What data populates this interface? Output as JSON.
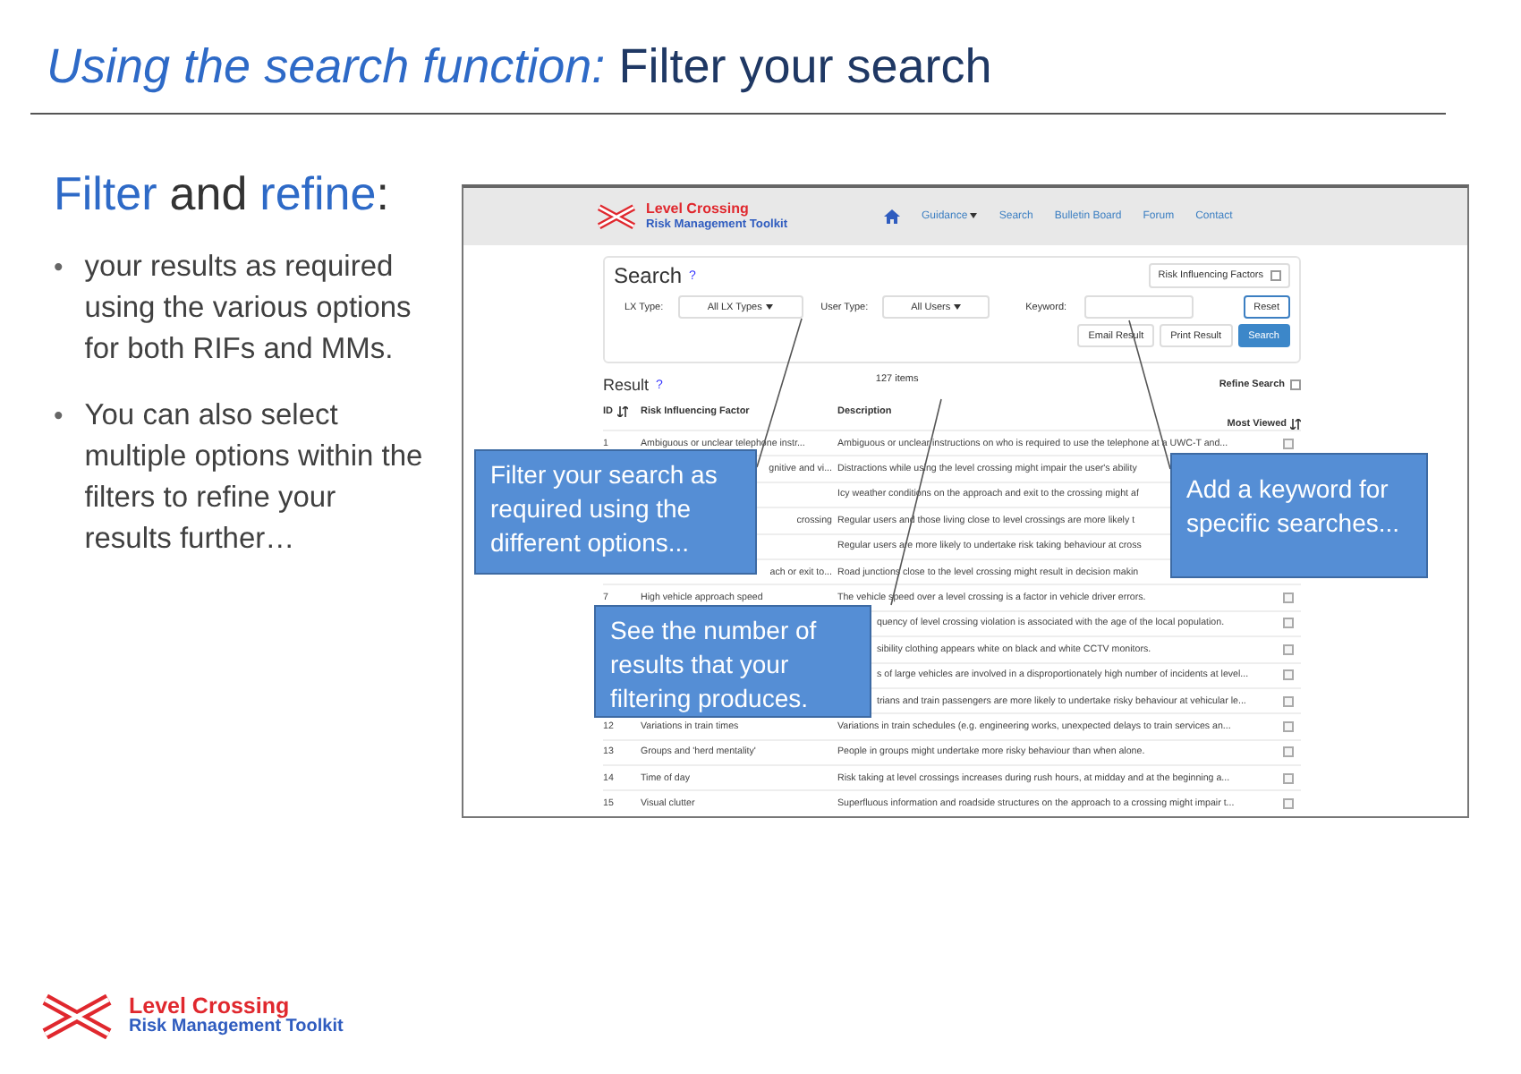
{
  "title": {
    "accent": "Using the search function:",
    "plain": "Filter your search"
  },
  "heading": [
    {
      "text": "Filter",
      "kind": "accent"
    },
    {
      "text": "and",
      "kind": "plain"
    },
    {
      "text": "refine",
      "kind": "accent"
    },
    {
      "text": ":",
      "kind": "plain"
    }
  ],
  "bullets": [
    {
      "marker": "•",
      "text": "your results as required using the various options for both RIFs and MMs."
    },
    {
      "marker": "•",
      "text": "You can also select multiple options within the filters to refine your results further…"
    }
  ],
  "screenshot": {
    "brand": {
      "line1": "Level Crossing",
      "line2": "Risk Management Toolkit"
    },
    "nav": [
      {
        "label": "Guidance",
        "dropdown": true
      },
      {
        "label": "Search",
        "dropdown": false
      },
      {
        "label": "Bulletin Board",
        "dropdown": false
      },
      {
        "label": "Forum",
        "dropdown": false
      },
      {
        "label": "Contact",
        "dropdown": false
      }
    ],
    "search": {
      "title": "Search",
      "help": "?",
      "category": "Risk Influencing Factors",
      "filters": [
        {
          "label": "LX Type:",
          "value": "All LX Types"
        },
        {
          "label": "User Type:",
          "value": "All Users"
        }
      ],
      "keyword_label": "Keyword:",
      "reset": {
        "label": "Reset",
        "kind": "outline"
      },
      "buttons": [
        {
          "label": "Email Result",
          "kind": "default"
        },
        {
          "label": "Print Result",
          "kind": "default"
        },
        {
          "label": "Search",
          "kind": "primary"
        }
      ]
    },
    "result": {
      "title": "Result",
      "help": "?",
      "count": "127 items",
      "refine_label": "Refine Search",
      "refine_checked": false
    },
    "table": {
      "columns": [
        {
          "label": "ID",
          "sortable": true
        },
        {
          "label": "Risk Influencing Factor",
          "sortable": false
        },
        {
          "label": "Description",
          "sortable": false
        },
        {
          "label": "Most Viewed",
          "sortable": true
        }
      ],
      "rows": [
        {
          "id": "1",
          "factor": "Ambiguous or unclear telephone instr...",
          "description": "Ambiguous or unclear instructions on who is required to use the telephone at a UWC-T and...",
          "checked": false
        },
        {
          "id": "",
          "factor": "gnitive and vi...",
          "description": "Distractions while using the level crossing might impair the user's ability"
        },
        {
          "id": "",
          "factor": "",
          "description": "Icy weather conditions on the approach and exit to the crossing might af"
        },
        {
          "id": "",
          "factor": "crossing",
          "description": "Regular users and those living close to level crossings are more likely t"
        },
        {
          "id": "",
          "factor": "",
          "description": "Regular users are more likely to undertake risk taking behaviour at cross"
        },
        {
          "id": "",
          "factor": "ach or exit to...",
          "description": "Road junctions close to the level crossing might result in decision makin"
        },
        {
          "id": "7",
          "factor": "High vehicle approach speed",
          "description": "The vehicle speed over a level crossing is a factor in vehicle driver errors.",
          "checked": false
        },
        {
          "id": "",
          "factor": "",
          "description": "quency of level crossing violation is associated with the age of the local population.",
          "checked": false
        },
        {
          "id": "",
          "factor": "",
          "description": "sibility clothing appears white on black and white CCTV monitors.",
          "checked": false
        },
        {
          "id": "",
          "factor": "",
          "description": "s of large vehicles are involved in a disproportionately high number of incidents at level...",
          "checked": false
        },
        {
          "id": "",
          "factor": "",
          "description": "trians and train passengers are more likely to undertake risky behaviour at vehicular le...",
          "checked": false
        },
        {
          "id": "12",
          "factor": "Variations in train times",
          "description": "Variations in train schedules (e.g. engineering works, unexpected delays to train services an...",
          "checked": false
        },
        {
          "id": "13",
          "factor": "Groups and 'herd mentality'",
          "description": "People in groups might undertake more risky behaviour than when alone.",
          "checked": false
        },
        {
          "id": "14",
          "factor": "Time of day",
          "description": "Risk taking at level crossings increases during rush hours, at midday and at the beginning a...",
          "checked": false
        },
        {
          "id": "15",
          "factor": "Visual clutter",
          "description": "Superfluous information and roadside structures on the approach to a crossing might impair t...",
          "checked": false
        }
      ]
    }
  },
  "callouts": [
    "Filter your search as required using the different options...",
    "See the number of results that your filtering produces.",
    "Add a keyword for specific searches..."
  ],
  "footer_logo": {
    "line1": "Level Crossing",
    "line2": "Risk Management Toolkit"
  }
}
